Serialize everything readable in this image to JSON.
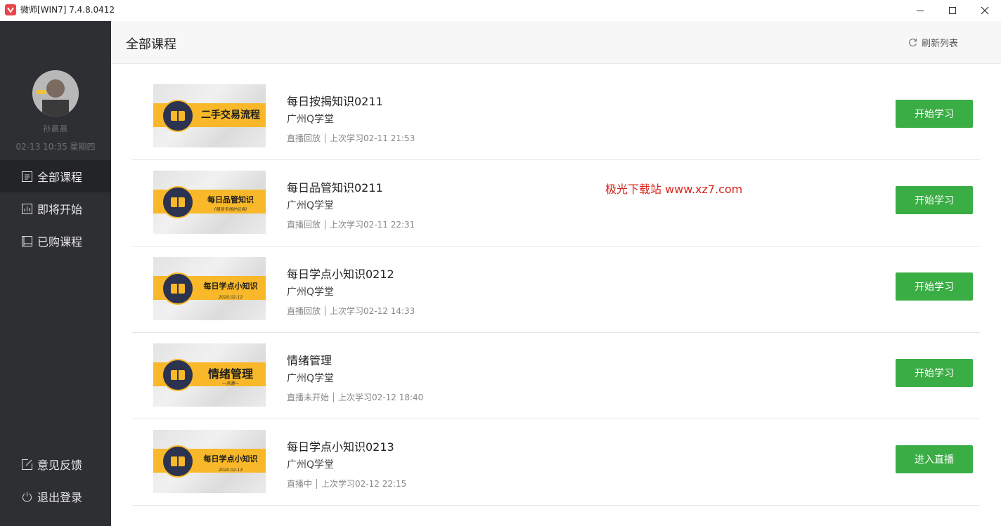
{
  "window": {
    "title": "微师[WIN7] 7.4.8.0412"
  },
  "sidebar": {
    "username": "孙晨晨",
    "datetime": "02-13 10:35 星期四",
    "nav": [
      {
        "label": "全部课程",
        "icon": "list-icon",
        "active": true
      },
      {
        "label": "即将开始",
        "icon": "chart-icon",
        "active": false
      },
      {
        "label": "已购课程",
        "icon": "bookmark-icon",
        "active": false
      }
    ],
    "bottom": [
      {
        "label": "意见反馈",
        "icon": "edit-icon"
      },
      {
        "label": "退出登录",
        "icon": "power-icon"
      }
    ]
  },
  "header": {
    "title": "全部课程",
    "refresh_label": "刷新列表"
  },
  "courses": [
    {
      "title": "每日按揭知识0211",
      "org": "广州Q学堂",
      "status": "直播回放",
      "last": "上次学习02-11 21:53",
      "button": "开始学习",
      "banner": "二手交易流程",
      "banner_sub": ""
    },
    {
      "title": "每日品管知识0211",
      "org": "广州Q学堂",
      "status": "直播回放",
      "last": "上次学习02-11 22:31",
      "button": "开始学习",
      "banner": "每日品管知识",
      "banner_sub": "(租赁专场护应务)"
    },
    {
      "title": "每日学点小知识0212",
      "org": "广州Q学堂",
      "status": "直播回放",
      "last": "上次学习02-12 14:33",
      "button": "开始学习",
      "banner": "每日学点小知识",
      "banner_sub": "2020.02.12"
    },
    {
      "title": "情绪管理",
      "org": "广州Q学堂",
      "status": "直播未开始",
      "last": "上次学习02-12 18:40",
      "button": "开始学习",
      "banner": "情绪管理",
      "banner_sub": "—陈蕾—"
    },
    {
      "title": "每日学点小知识0213",
      "org": "广州Q学堂",
      "status": "直播中",
      "last": "上次学习02-12 22:15",
      "button": "进入直播",
      "banner": "每日学点小知识",
      "banner_sub": "2020.02.13"
    }
  ],
  "watermark": "极光下载站 www.xz7.com",
  "colors": {
    "sidebar_bg": "#2e2f33",
    "accent_green": "#3aad45",
    "banner_yellow": "#f8b829",
    "watermark_red": "#d9251c"
  }
}
